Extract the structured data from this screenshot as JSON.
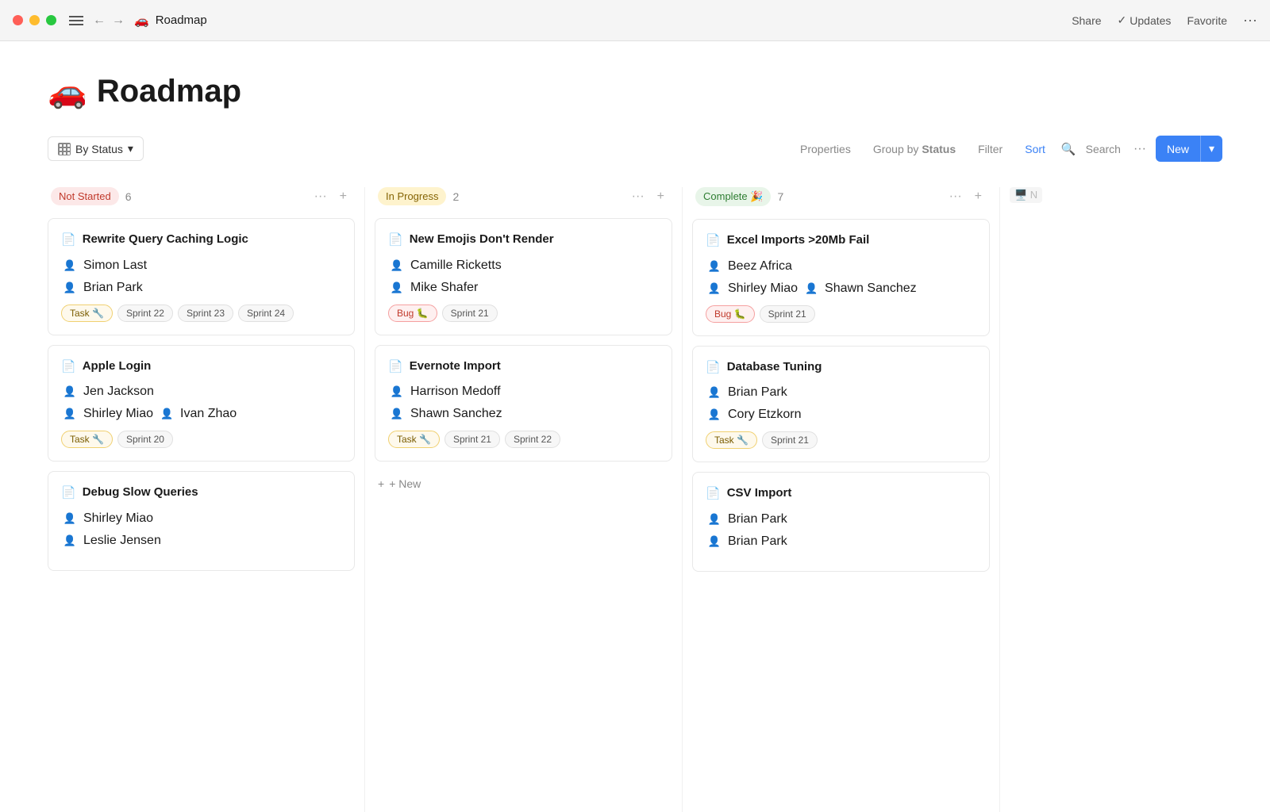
{
  "titleBar": {
    "pageEmoji": "🚗",
    "pageTitle": "Roadmap",
    "share": "Share",
    "updates": "Updates",
    "favorite": "Favorite",
    "more": "···"
  },
  "toolbar": {
    "byStatus": "By Status",
    "properties": "Properties",
    "groupBy": "Group by",
    "groupByValue": "Status",
    "filter": "Filter",
    "sort": "Sort",
    "search": "Search",
    "newButton": "New"
  },
  "columns": [
    {
      "id": "not-started",
      "status": "Not Started",
      "statusClass": "status-not-started",
      "count": "6",
      "cards": [
        {
          "title": "Rewrite Query Caching Logic",
          "assignees": [
            "Simon Last",
            "Brian Park"
          ],
          "avatars": [
            "👤",
            "👤"
          ],
          "typeTag": "Task 🔧",
          "typeClass": "tag-task",
          "sprints": [
            "Sprint 22",
            "Sprint 23",
            "Sprint 24"
          ]
        },
        {
          "title": "Apple Login",
          "assignees": [
            "Jen Jackson",
            "Shirley Miao",
            "Ivan Zhao"
          ],
          "avatars": [
            "👤",
            "👤",
            "👤"
          ],
          "typeTag": "Task 🔧",
          "typeClass": "tag-task",
          "sprints": [
            "Sprint 20"
          ]
        },
        {
          "title": "Debug Slow Queries",
          "assignees": [
            "Shirley Miao",
            "Leslie Jensen"
          ],
          "avatars": [
            "👤",
            "👤"
          ],
          "typeTag": null,
          "sprints": []
        }
      ]
    },
    {
      "id": "in-progress",
      "status": "In Progress",
      "statusClass": "status-in-progress",
      "count": "2",
      "cards": [
        {
          "title": "New Emojis Don't Render",
          "assignees": [
            "Camille Ricketts",
            "Mike Shafer"
          ],
          "avatars": [
            "👤",
            "👤"
          ],
          "typeTag": "Bug 🐛",
          "typeClass": "tag-bug",
          "sprints": [
            "Sprint 21"
          ]
        },
        {
          "title": "Evernote Import",
          "assignees": [
            "Harrison Medoff",
            "Shawn Sanchez"
          ],
          "avatars": [
            "👤",
            "👤"
          ],
          "typeTag": "Task 🔧",
          "typeClass": "tag-task",
          "sprints": [
            "Sprint 21",
            "Sprint 22"
          ]
        }
      ],
      "newItemLabel": "+ New"
    },
    {
      "id": "complete",
      "status": "Complete 🎉",
      "statusClass": "status-complete",
      "count": "7",
      "cards": [
        {
          "title": "Excel Imports >20Mb Fail",
          "assignees": [
            "Beez Africa",
            "Shirley Miao",
            "Shawn Sanchez"
          ],
          "avatars": [
            "👤",
            "👤",
            "👤"
          ],
          "typeTag": "Bug 🐛",
          "typeClass": "tag-bug",
          "sprints": [
            "Sprint 21"
          ]
        },
        {
          "title": "Database Tuning",
          "assignees": [
            "Brian Park",
            "Cory Etzkorn"
          ],
          "avatars": [
            "👤",
            "👤"
          ],
          "typeTag": "Task 🔧",
          "typeClass": "tag-task",
          "sprints": [
            "Sprint 21"
          ]
        },
        {
          "title": "CSV Import",
          "assignees": [
            "Brian Park",
            "Brian Park"
          ],
          "avatars": [
            "👤",
            "👤"
          ],
          "typeTag": null,
          "sprints": []
        }
      ]
    }
  ],
  "hiddenColumn": {
    "label": "N..."
  }
}
